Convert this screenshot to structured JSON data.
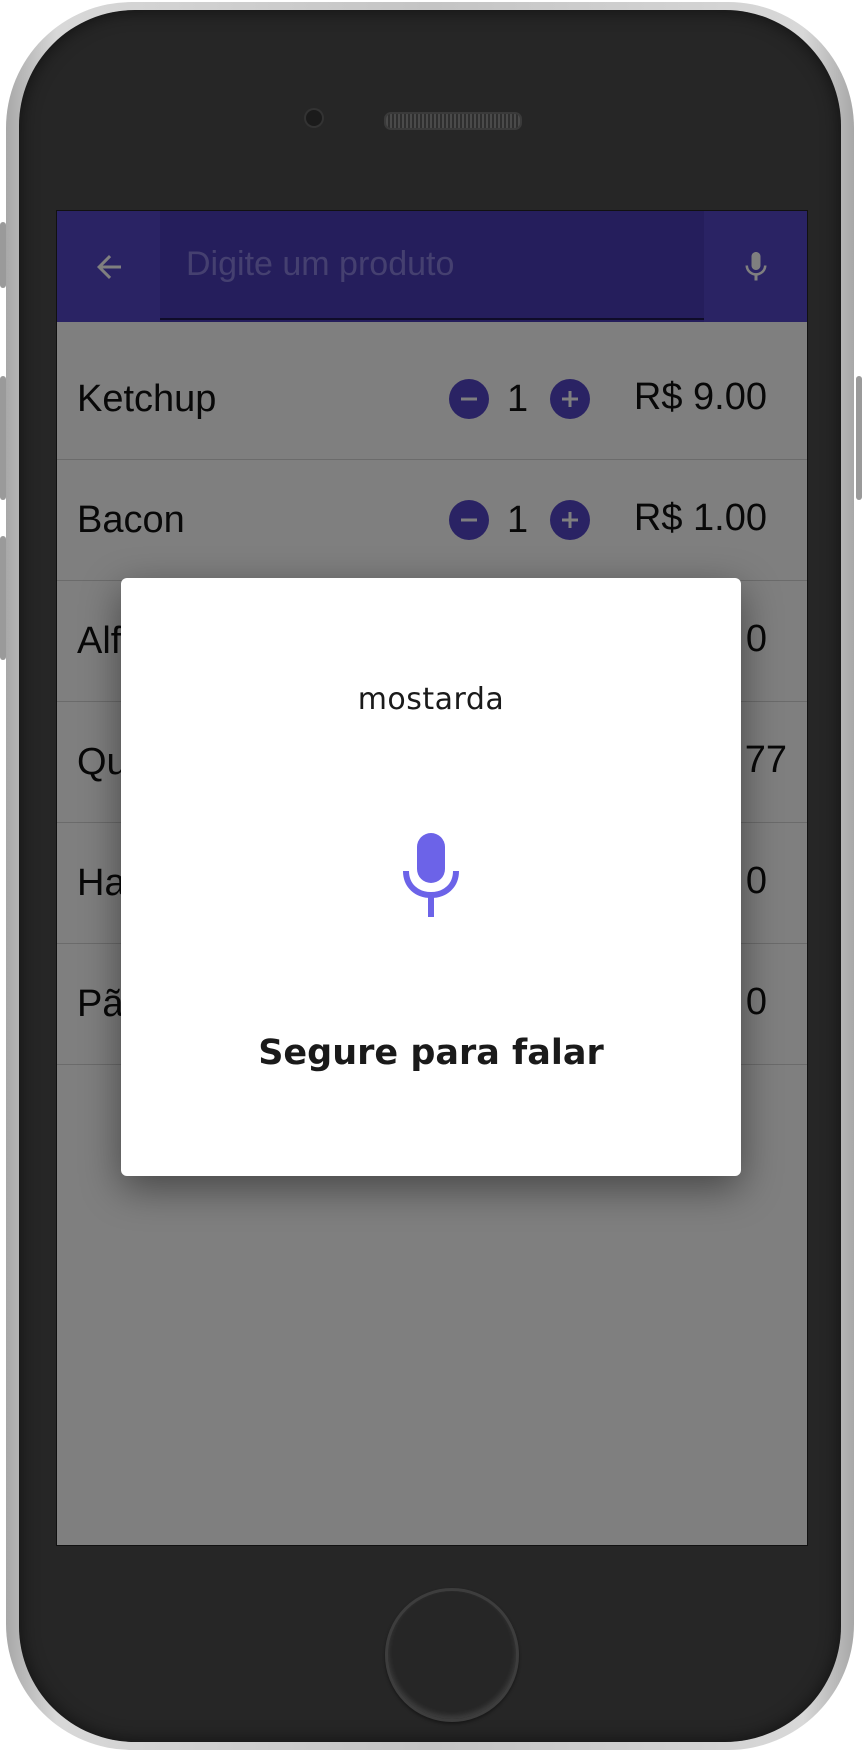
{
  "appbar": {
    "search_placeholder": "Digite um produto",
    "back_icon": "arrow-back-icon",
    "mic_icon": "microphone-icon",
    "color": "#5546c8"
  },
  "cart": {
    "items": [
      {
        "name": "Ketchup",
        "qty": "1",
        "price": "R$ 9.00"
      },
      {
        "name": "Bacon",
        "qty": "1",
        "price": "R$ 1.00"
      },
      {
        "name": "Alf",
        "qty": "",
        "price": "0"
      },
      {
        "name": "Qu",
        "qty": "",
        "price": "77"
      },
      {
        "name": "Ha",
        "qty": "",
        "price": "0"
      },
      {
        "name": "Pã",
        "qty": "",
        "price": "0"
      }
    ]
  },
  "voice_dialog": {
    "recognized_text": "mostarda",
    "hint": "Segure para falar",
    "mic_color": "#6c63e8"
  }
}
